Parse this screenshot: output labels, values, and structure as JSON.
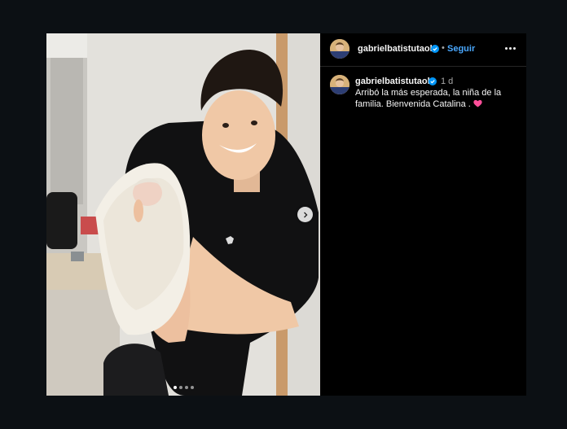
{
  "post": {
    "username": "gabrielbatistutaok",
    "follow_label": "Seguir",
    "separator": "•",
    "caption_time": "1 d",
    "caption_text": "Arribó la más esperada, la niña de la familia. Bienvenida Catalina .",
    "carousel": {
      "slides": 4,
      "active_index": 0
    }
  },
  "icons": {
    "verified": "verified-badge-icon",
    "more": "more-options-icon",
    "next": "chevron-right-icon",
    "heart": "pink-heart-emoji"
  },
  "colors": {
    "background": "#0c1014",
    "panel": "#000000",
    "accent": "#4aa8ff",
    "verified": "#0095f6",
    "heart": "#ff4f9a"
  }
}
